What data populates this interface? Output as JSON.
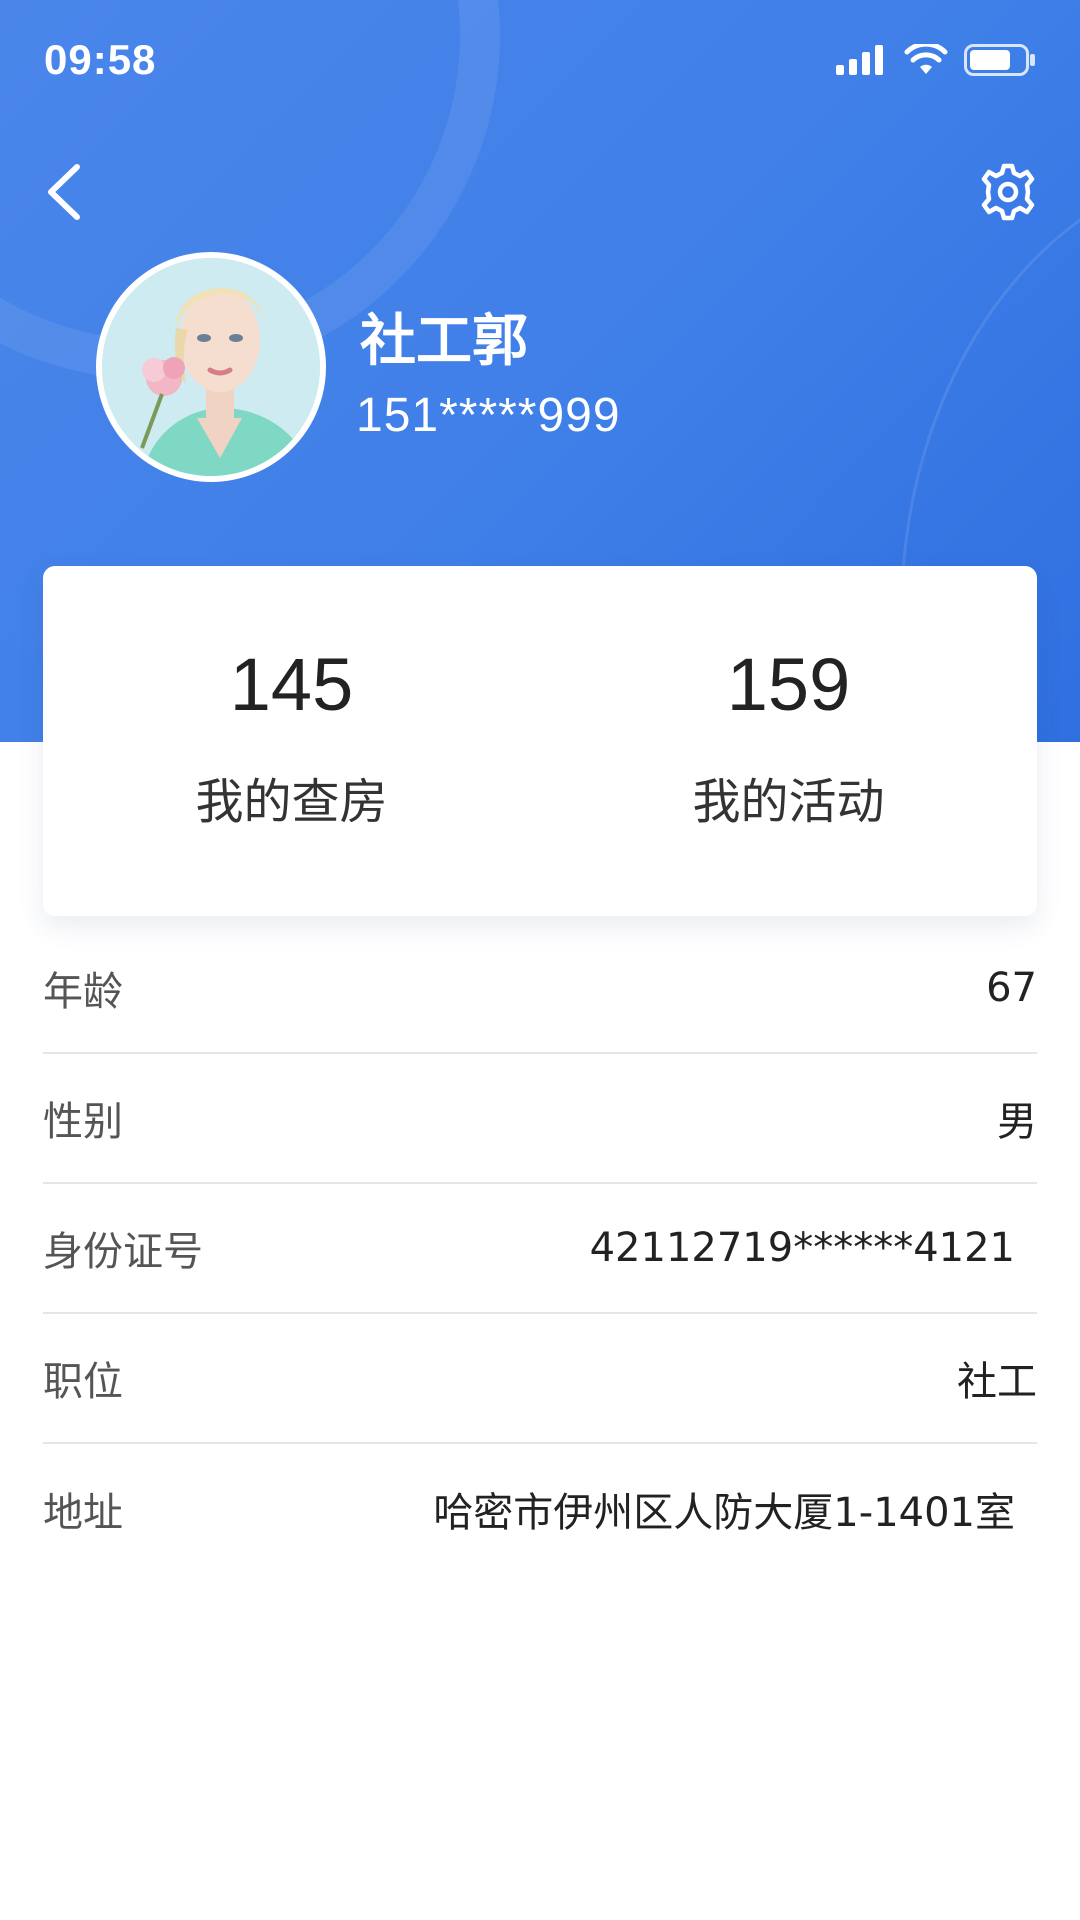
{
  "status_bar": {
    "time": "09:58",
    "icons": [
      "signal-icon",
      "wifi-icon",
      "battery-icon"
    ]
  },
  "header": {
    "back_icon": "chevron-left-icon",
    "settings_icon": "gear-icon",
    "user": {
      "name": "社工郭",
      "phone": "151*****999"
    }
  },
  "stats": [
    {
      "value": "145",
      "label": "我的查房"
    },
    {
      "value": "159",
      "label": "我的活动"
    }
  ],
  "info": [
    {
      "label": "年龄",
      "value": "67"
    },
    {
      "label": "性别",
      "value": "男"
    },
    {
      "label": "身份证号",
      "value": "42112719******4121"
    },
    {
      "label": "职位",
      "value": "社工"
    },
    {
      "label": "地址",
      "value": "哈密市伊州区人防大厦1-1401室"
    }
  ],
  "colors": {
    "header_blue": "#3f7fe8",
    "text_dark": "#222222",
    "text_label": "#555555",
    "divider": "#e6e6e6"
  }
}
